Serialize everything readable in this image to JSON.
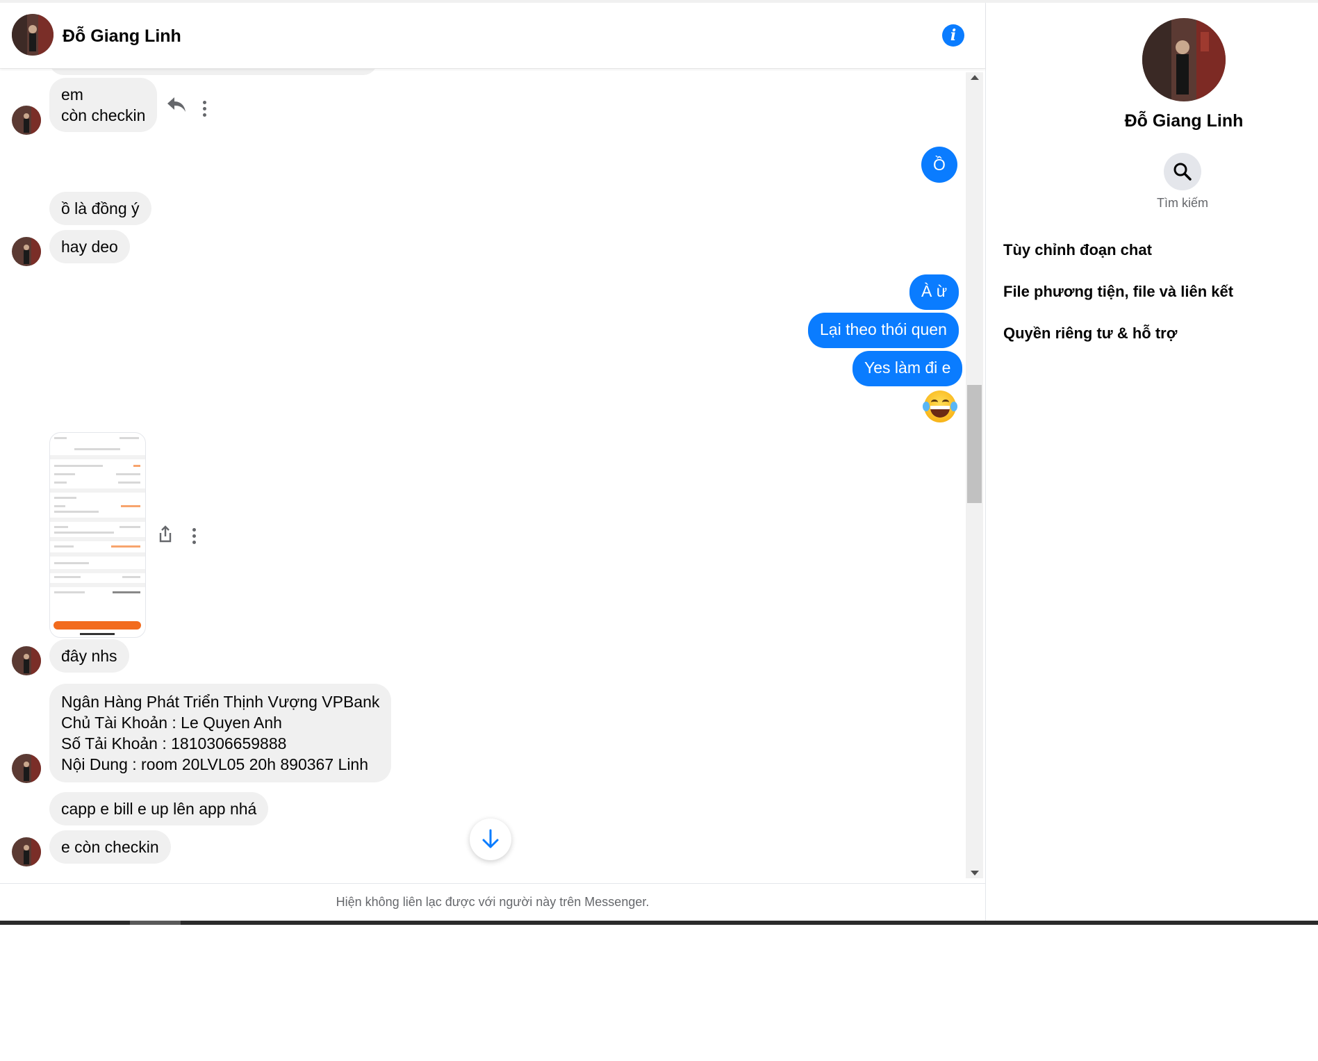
{
  "contact": {
    "name": "Đỗ Giang Linh"
  },
  "messages": {
    "m1": "em\ncòn checkin",
    "m2": "Ồ",
    "m3": "ồ là đồng ý",
    "m4": "hay deo",
    "m5": "À ừ",
    "m6": "Lại theo thói quen",
    "m7": "Yes làm đi e",
    "m8": "đây nhs",
    "m9": "Ngân Hàng Phát Triển Thịnh Vượng VPBank\nChủ Tài Khoản : Le Quyen Anh\nSố Tải Khoản : 1810306659888\nNội Dung : room 20LVL05 20h 890367 Linh",
    "m10": "capp e bill e up lên app nhá",
    "m11": "e còn checkin"
  },
  "footer": {
    "note": "Hiện không liên lạc được với người này trên Messenger."
  },
  "side_panel": {
    "search_label": "Tìm kiếm",
    "items": [
      "Tùy chỉnh đoạn chat",
      "File phương tiện, file và liên kết",
      "Quyền riêng tư & hỗ trợ"
    ]
  },
  "icons": {
    "info": "info-icon",
    "reply": "reply-icon",
    "more": "more-vertical-icon",
    "share": "share-icon",
    "scroll_down": "arrow-down-icon",
    "search": "search-icon",
    "emoji": "tears-of-joy-emoji"
  },
  "colors": {
    "accent": "#0a7cff",
    "incoming_bubble": "#f0f0f0",
    "secondary_text": "#65676b"
  }
}
